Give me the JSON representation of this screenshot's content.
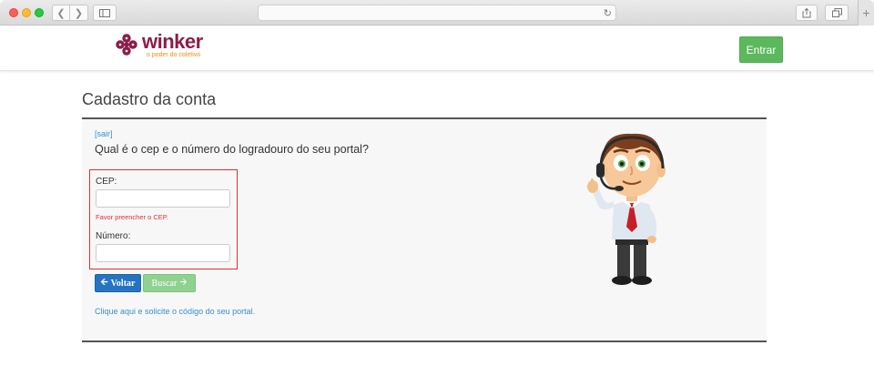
{
  "browser": {
    "icons": {
      "back": "chevron-left-icon",
      "forward": "chevron-right-icon",
      "sidebar": "sidebar-icon",
      "reload": "reload-icon",
      "share": "share-icon",
      "tabs": "tabs-icon",
      "new_tab": "plus-icon"
    },
    "traffic_lights": [
      "#fc5f57",
      "#fdbc2e",
      "#28c840"
    ]
  },
  "header": {
    "logo_word": "winker",
    "logo_tagline": "o poder do coletivo",
    "login_label": "Entrar",
    "colors": {
      "brand": "#8e1d4a",
      "tagline": "#f08a1c",
      "login_bg": "#5cb85c"
    }
  },
  "page": {
    "title": "Cadastro da conta"
  },
  "form": {
    "exit_link": "[sair]",
    "question": "Qual é o cep e o número do logradouro do seu portal?",
    "cep_label": "CEP:",
    "cep_value": "",
    "cep_error": "Favor preencher o CEP.",
    "numero_label": "Número:",
    "numero_value": "",
    "back_label": "Voltar",
    "search_label": "Buscar",
    "help_link": "Clique aqui e solicite o código do seu portal.",
    "colors": {
      "error": "#e0303a",
      "link": "#3a8dd1",
      "back_bg": "#2574c4",
      "search_bg": "#8fd28f"
    }
  }
}
